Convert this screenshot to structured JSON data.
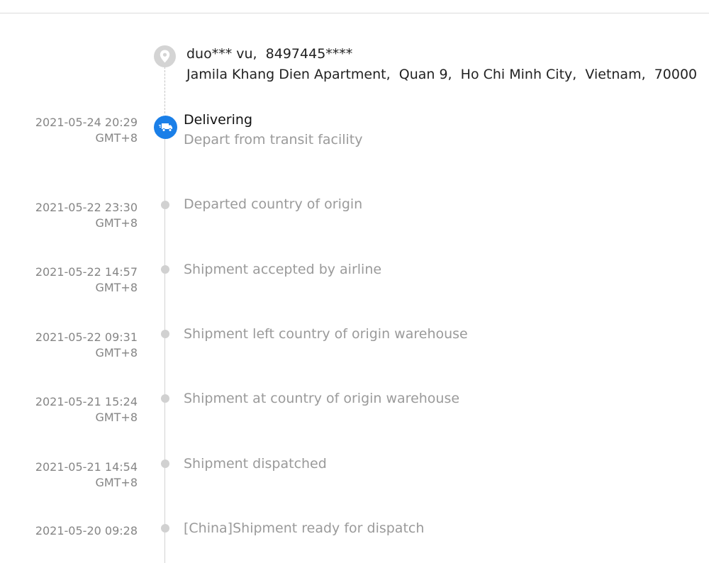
{
  "address": {
    "recipient_line": "duo*** vu,  8497445****",
    "location_line": "Jamila Khang Dien Apartment,  Quan 9,  Ho Chi Minh City,  Vietnam,  70000",
    "icon": "location-pin-icon"
  },
  "current": {
    "title": "Delivering",
    "detail": "Depart from transit facility",
    "date": "2021-05-24 20:29",
    "tz": "GMT+8",
    "icon": "delivery-truck-icon",
    "accent_color": "#1a7fe8"
  },
  "events": [
    {
      "date": "2021-05-22 23:30",
      "tz": "GMT+8",
      "text": "Departed country of origin"
    },
    {
      "date": "2021-05-22 14:57",
      "tz": "GMT+8",
      "text": "Shipment accepted by airline"
    },
    {
      "date": "2021-05-22 09:31",
      "tz": "GMT+8",
      "text": "Shipment left country of origin warehouse"
    },
    {
      "date": "2021-05-21 15:24",
      "tz": "GMT+8",
      "text": "Shipment at country of origin warehouse"
    },
    {
      "date": "2021-05-21 14:54",
      "tz": "GMT+8",
      "text": "Shipment dispatched"
    },
    {
      "date": "2021-05-20 09:28",
      "tz": "",
      "text": "[China]Shipment ready for dispatch"
    }
  ]
}
